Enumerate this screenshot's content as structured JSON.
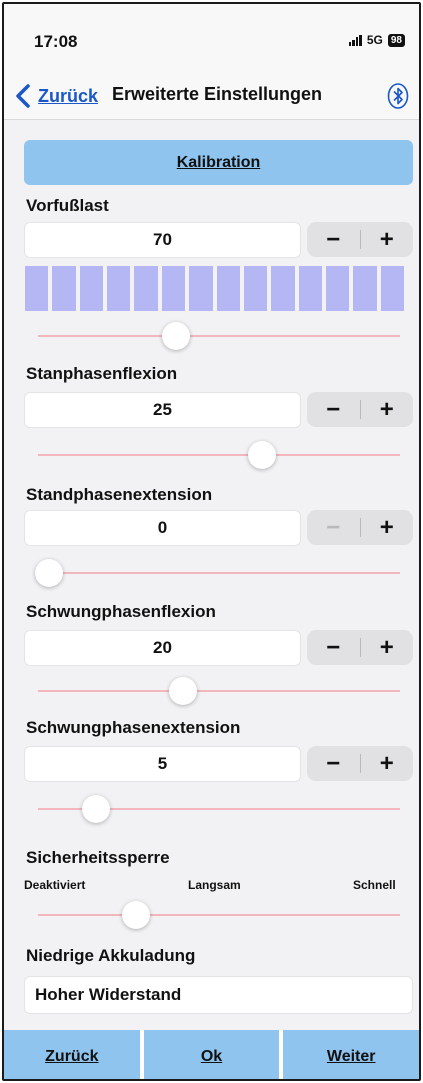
{
  "status_bar": {
    "time": "17:08",
    "network": "5G",
    "battery": "98"
  },
  "nav": {
    "back_label": "Zurück",
    "title": "Erweiterte Einstellungen",
    "bluetooth_icon": "bluetooth-icon"
  },
  "calibration": {
    "label": "Kalibration"
  },
  "forefoot_load": {
    "label": "Vorfußlast",
    "value": "70",
    "slider_fraction": 0.38,
    "level_segments": 14,
    "segment_color": "#b5b7f4"
  },
  "stance_flexion": {
    "label": "Stanphasenflexion",
    "value": "25",
    "slider_fraction": 0.62
  },
  "stance_extension": {
    "label": "Standphasenextension",
    "value": "0",
    "slider_fraction": 0.03,
    "minus_disabled": true
  },
  "swing_flexion": {
    "label": "Schwungphasenflexion",
    "value": "20",
    "slider_fraction": 0.4
  },
  "swing_extension": {
    "label": "Schwungphasenextension",
    "value": "5",
    "slider_fraction": 0.16
  },
  "safety_lock": {
    "label": "Sicherheitssperre",
    "levels": [
      "Deaktiviert",
      "Langsam",
      "Schnell"
    ],
    "slider_fraction": 0.27
  },
  "low_battery": {
    "label": "Niedrige Akkuladung",
    "value": "Hoher Widerstand"
  },
  "stepper_symbols": {
    "minus": "−",
    "plus": "+"
  },
  "footer": {
    "back": "Zurück",
    "ok": "Ok",
    "next": "Weiter"
  },
  "colors": {
    "accent_button": "#8fc4ef",
    "link": "#1a57c8",
    "slider_track": "#f2b6be"
  }
}
